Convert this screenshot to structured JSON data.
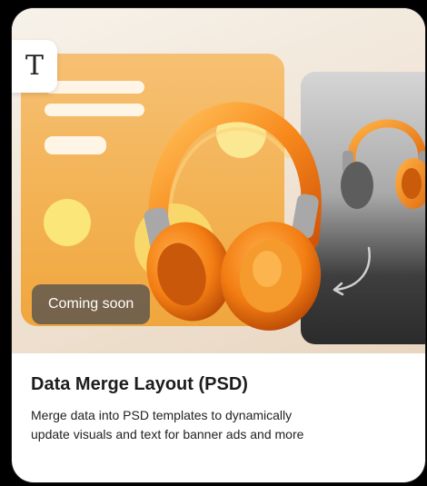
{
  "card": {
    "badge": "Coming soon",
    "title": "Data Merge Layout (PSD)",
    "description": "Merge data into PSD templates to dynamically update visuals and text for banner ads and more",
    "text_tool_glyph": "T",
    "icons": [
      "text-tool-icon",
      "headphones-illustration",
      "curved-arrow-icon"
    ],
    "colors": {
      "accent_orange": "#f5a623",
      "panel_orange": "#f3b253",
      "badge_bg": "#5a544e"
    }
  }
}
